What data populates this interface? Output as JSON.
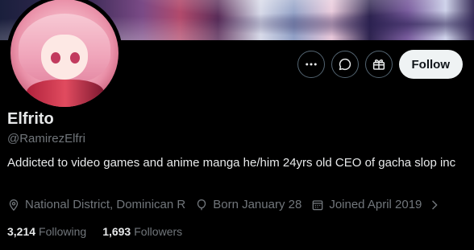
{
  "profile": {
    "name": "Elfrito",
    "handle": "@RamirezElfri",
    "bio": "Addicted to video games and anime manga he/him 24yrs old CEO of gacha slop inc",
    "location": "National District, Dominican R",
    "birthday": "Born January 28",
    "joined": "Joined April 2019"
  },
  "actions": {
    "more_icon": "more-icon",
    "message_icon": "message-icon",
    "gift_icon": "gift-icon",
    "follow_label": "Follow"
  },
  "stats": {
    "following_count": "3,214",
    "following_label": "Following",
    "followers_count": "1,693",
    "followers_label": "Followers"
  },
  "colors": {
    "background": "#000000",
    "text": "#e7e9ea",
    "muted": "#71767b",
    "follow_bg": "#eff3f4"
  }
}
